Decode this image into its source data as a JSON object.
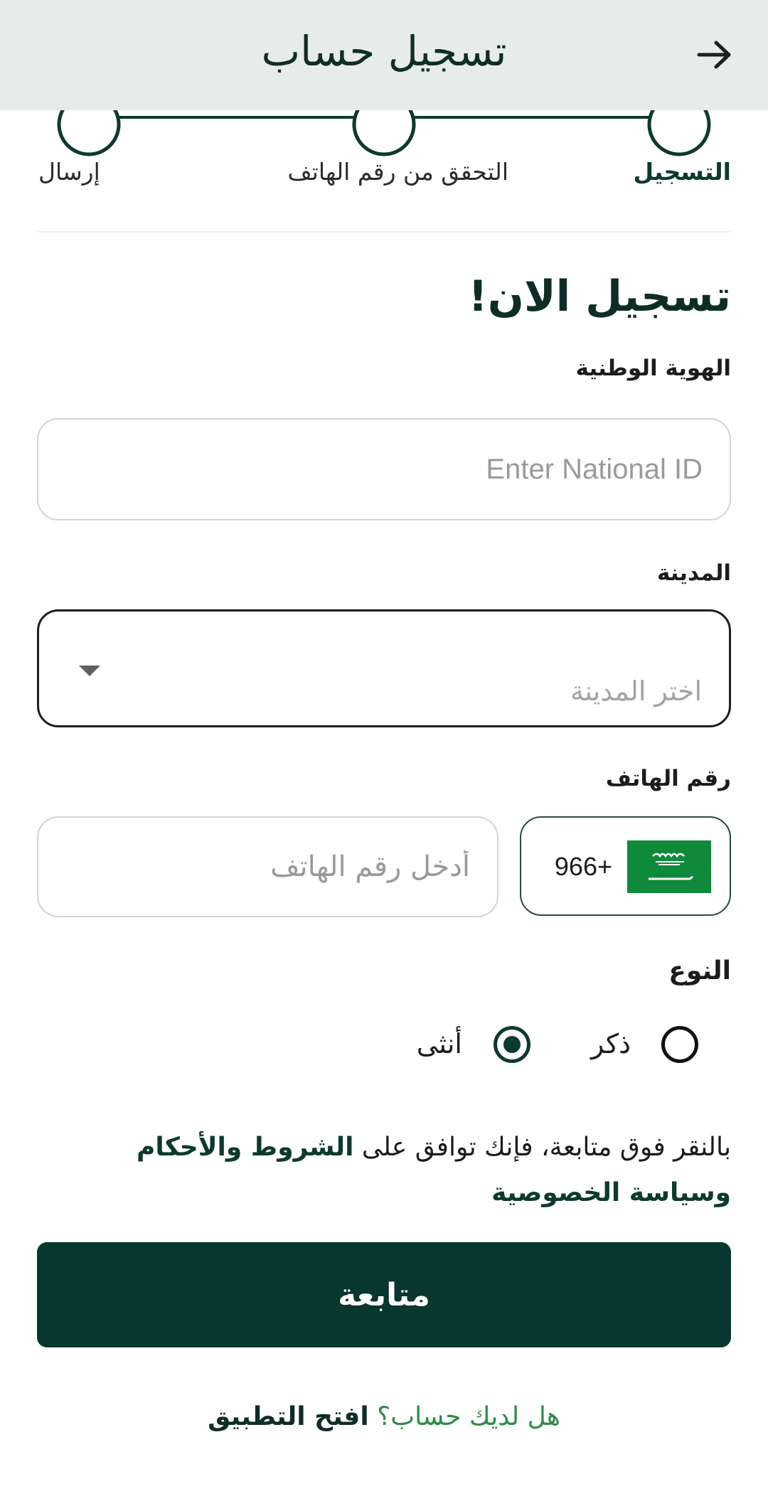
{
  "appbar": {
    "title": "تسجيل حساب",
    "back_icon": "arrow-right-icon"
  },
  "stepper": {
    "steps": [
      {
        "label": "التسجيل",
        "active": true
      },
      {
        "label": "التحقق من رقم الهاتف",
        "active": false
      },
      {
        "label": "إرسال",
        "active": false
      }
    ]
  },
  "form": {
    "heading": "تسجيل الان!",
    "national_id": {
      "label": "الهوية الوطنية",
      "placeholder": "Enter National ID",
      "value": ""
    },
    "city": {
      "label": "المدينة",
      "placeholder": "اختر المدينة",
      "value": ""
    },
    "phone": {
      "label": "رقم الهاتف",
      "country_code": "966+",
      "flag": "saudi-flag-icon",
      "placeholder": "أدخل رقم الهاتف",
      "value": ""
    },
    "gender": {
      "label": "النوع",
      "options": [
        {
          "label": "ذكر",
          "selected": false
        },
        {
          "label": "أنثى",
          "selected": true
        }
      ]
    }
  },
  "terms": {
    "prefix": "بالنقر فوق متابعة، فإنك توافق على",
    "terms_link": "الشروط والأحكام",
    "privacy_link": "وسياسة الخصوصية"
  },
  "cta": {
    "label": "متابعة"
  },
  "footer": {
    "question": "هل لديك حساب؟",
    "link": "افتح التطبيق"
  },
  "colors": {
    "primary": "#07372e",
    "accent_green": "#2e8b47",
    "appbar_bg": "#e7ebe9"
  }
}
